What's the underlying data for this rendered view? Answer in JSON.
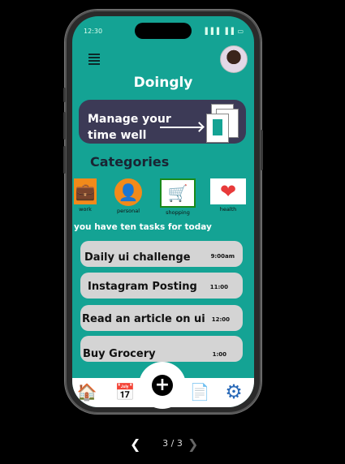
{
  "status": {
    "time": "12:30",
    "icons": "▐▐▐ ▐▐ ▭"
  },
  "app": {
    "title": "Doingly"
  },
  "banner": {
    "text": "Manage your time well"
  },
  "categories": {
    "title": "Categories",
    "items": [
      {
        "label": "work",
        "icon": "briefcase-icon",
        "glyph": "💼",
        "color": "#f28a1a"
      },
      {
        "label": "personal",
        "icon": "person-icon",
        "glyph": "👤",
        "color": "#f28a1a"
      },
      {
        "label": "shopping",
        "icon": "cart-icon",
        "glyph": "🛒",
        "color": "#1a8a1a"
      },
      {
        "label": "health",
        "icon": "heart-icon",
        "glyph": "❤",
        "color": "#e83a3a"
      }
    ]
  },
  "tasks_header": "you have ten tasks for today",
  "tasks": [
    {
      "name": "Daily ui challenge",
      "time": "9:00am"
    },
    {
      "name": "Instagram Posting",
      "time": "11:00"
    },
    {
      "name": "Read an article on ui",
      "time": "12:00"
    },
    {
      "name": "Buy Grocery",
      "time": "1:00"
    }
  ],
  "nav": {
    "items": [
      {
        "icon": "home-icon",
        "glyph": "🏠"
      },
      {
        "icon": "calendar-icon",
        "glyph": "📅"
      },
      {
        "icon": "add-icon",
        "glyph": "+"
      },
      {
        "icon": "document-icon",
        "glyph": "📄"
      },
      {
        "icon": "settings-icon",
        "glyph": "⚙"
      }
    ]
  },
  "pager": {
    "text": "3 / 3"
  },
  "colors": {
    "screen_bg": "#14a394",
    "banner_bg": "#3c3a56",
    "task_bg": "#d4d4d4"
  }
}
